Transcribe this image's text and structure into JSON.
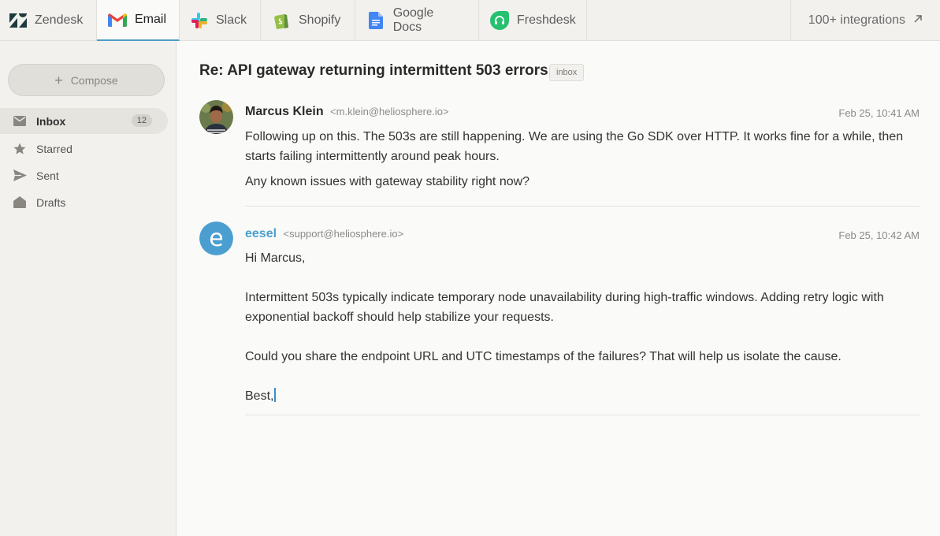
{
  "tabs": [
    {
      "label": "Zendesk",
      "icon": "zendesk-icon"
    },
    {
      "label": "Email",
      "icon": "gmail-icon",
      "active": true
    },
    {
      "label": "Slack",
      "icon": "slack-icon"
    },
    {
      "label": "Shopify",
      "icon": "shopify-icon"
    },
    {
      "label": "Google Docs",
      "icon": "google-docs-icon"
    },
    {
      "label": "Freshdesk",
      "icon": "freshdesk-icon"
    }
  ],
  "integrations": {
    "label": "100+ integrations",
    "icon": "arrow-up-right-icon"
  },
  "sidebar": {
    "compose_label": "Compose",
    "items": [
      {
        "label": "Inbox",
        "icon": "mail-icon",
        "count": "12",
        "active": true
      },
      {
        "label": "Starred",
        "icon": "star-icon"
      },
      {
        "label": "Sent",
        "icon": "send-icon"
      },
      {
        "label": "Drafts",
        "icon": "drafts-icon"
      }
    ]
  },
  "thread": {
    "subject": "Re: API gateway returning intermittent 503 errors",
    "tag": "inbox",
    "messages": [
      {
        "name": "Marcus Klein",
        "email": "<m.klein@heliosphere.io>",
        "date": "Feb 25, 10:41 AM",
        "body": [
          "Following up on this. The 503s are still happening. We are using the Go SDK over HTTP. It works fine for a while, then starts failing intermittently around peak hours.",
          "Any known issues with gateway stability right now?"
        ]
      },
      {
        "name": "eesel",
        "email": "<support@heliosphere.io>",
        "date": "Feb 25, 10:42 AM",
        "avatar_letter": "e",
        "body": [
          "Hi Marcus,",
          "Intermittent 503s typically indicate temporary node unavailability during high-traffic windows. Adding retry logic with exponential backoff should help stabilize your requests.",
          "Could you share the endpoint URL and UTC timestamps of the failures? That will help us isolate the cause.",
          "Best,"
        ]
      }
    ]
  },
  "colors": {
    "accent": "#4a9fd0",
    "sidebar_bg": "#f2f1ee",
    "main_bg": "#fafaf8"
  }
}
